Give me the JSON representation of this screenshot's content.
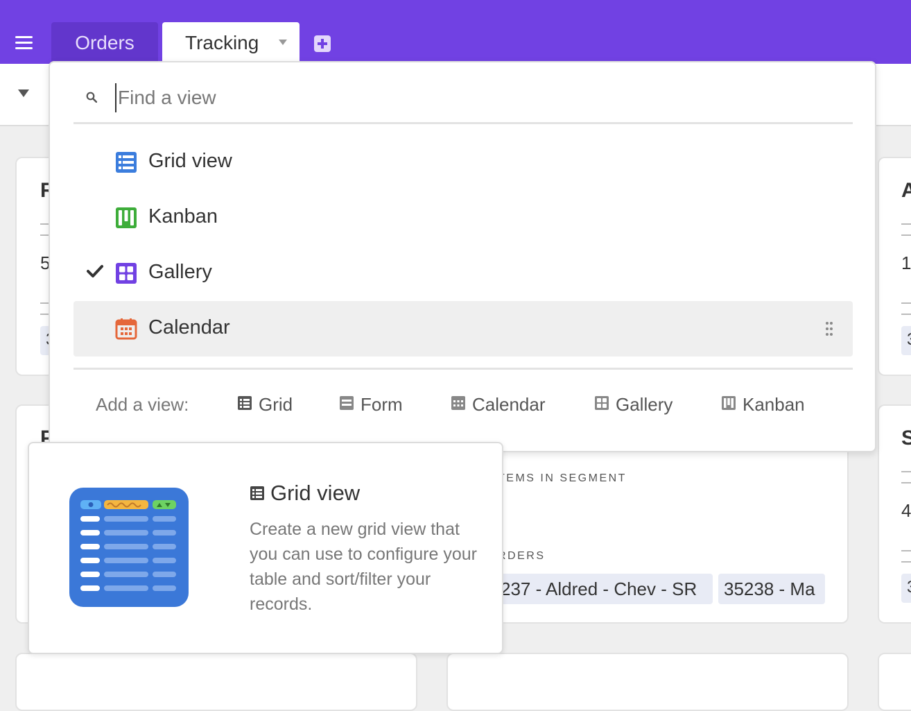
{
  "header": {
    "tabs": [
      {
        "label": "Orders"
      },
      {
        "label": "Tracking"
      }
    ]
  },
  "background_cards": {
    "card1": {
      "title_fragment": "R",
      "value_fragment": "5",
      "chip_fragment": "3"
    },
    "card2": {
      "title_fragment": "P"
    },
    "card3": {
      "segment_label": "TEMS IN SEGMENT",
      "orders_label": "RDERS",
      "pills": [
        "237 - Aldred - Chev - SR",
        "35238 - Ma"
      ]
    },
    "card_right1": {
      "title_fragment": "A",
      "value_fragment": "1",
      "chip_fragment": "3"
    },
    "card_right2": {
      "title_fragment": "S",
      "value_fragment": "4",
      "chip_fragment": "3"
    }
  },
  "view_switcher": {
    "search": {
      "placeholder": "Find a view",
      "value": ""
    },
    "views": [
      {
        "label": "Grid view",
        "icon": "grid-icon",
        "color": "#3b7ddd",
        "selected": false
      },
      {
        "label": "Kanban",
        "icon": "kanban-icon",
        "color": "#3ead3a",
        "selected": false
      },
      {
        "label": "Gallery",
        "icon": "gallery-icon",
        "color": "#7141e3",
        "selected": true
      },
      {
        "label": "Calendar",
        "icon": "calendar-icon",
        "color": "#e5673a",
        "selected": false,
        "highlighted": true
      }
    ],
    "add_view": {
      "label": "Add a view:",
      "options": [
        {
          "label": "Grid",
          "icon": "grid-icon"
        },
        {
          "label": "Form",
          "icon": "form-icon"
        },
        {
          "label": "Calendar",
          "icon": "calendar-icon"
        },
        {
          "label": "Gallery",
          "icon": "gallery-icon"
        },
        {
          "label": "Kanban",
          "icon": "kanban-icon"
        }
      ]
    }
  },
  "tooltip": {
    "title": "Grid view",
    "description": "Create a new grid view that you can use to configure your table and sort/filter your records."
  },
  "colors": {
    "brand": "#7141e3",
    "grid": "#3b7ddd",
    "kanban": "#3ead3a",
    "gallery": "#7141e3",
    "calendar": "#e5673a"
  }
}
